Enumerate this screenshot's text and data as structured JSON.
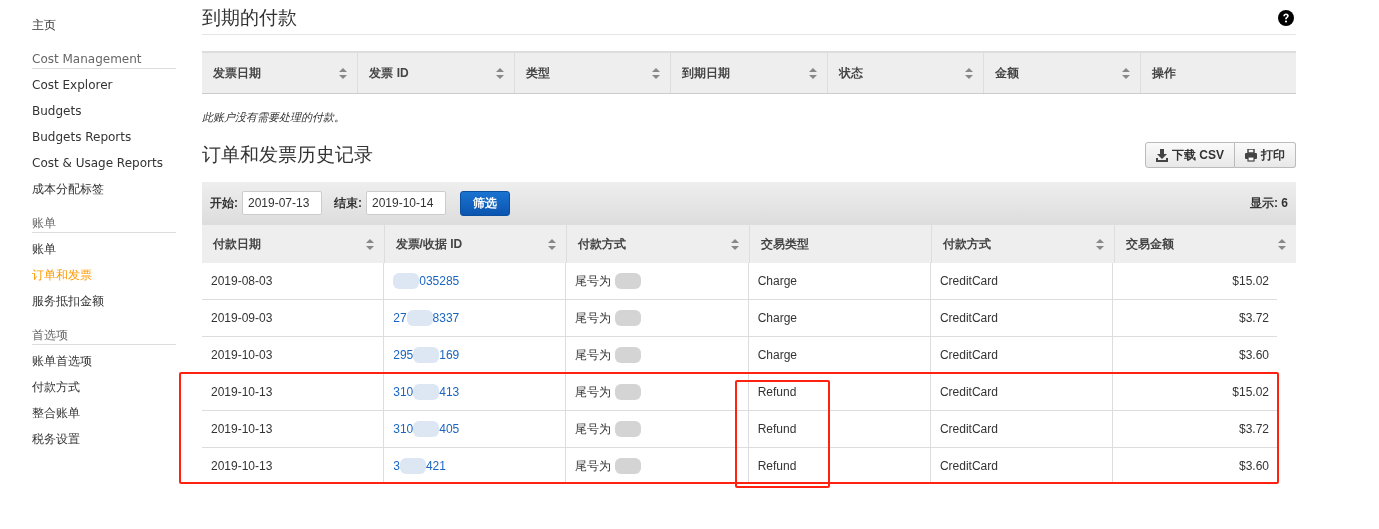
{
  "sidebar": {
    "sections": [
      {
        "items": [
          {
            "label": "主页",
            "selected": false
          }
        ]
      },
      {
        "heading": "Cost Management",
        "items": [
          {
            "label": "Cost Explorer",
            "selected": false
          },
          {
            "label": "Budgets",
            "selected": false
          },
          {
            "label": "Budgets Reports",
            "selected": false
          },
          {
            "label": "Cost & Usage Reports",
            "selected": false
          },
          {
            "label": "成本分配标签",
            "selected": false
          }
        ]
      },
      {
        "heading": "账单",
        "items": [
          {
            "label": "账单",
            "selected": false
          },
          {
            "label": "订单和发票",
            "selected": true
          },
          {
            "label": "服务抵扣金额",
            "selected": false
          }
        ]
      },
      {
        "heading": "首选项",
        "items": [
          {
            "label": "账单首选项",
            "selected": false
          },
          {
            "label": "付款方式",
            "selected": false
          },
          {
            "label": "整合账单",
            "selected": false
          },
          {
            "label": "税务设置",
            "selected": false
          }
        ]
      }
    ]
  },
  "due_payments": {
    "title": "到期的付款",
    "columns": [
      {
        "label": "发票日期",
        "sortable": true
      },
      {
        "label": "发票 ID",
        "sortable": true
      },
      {
        "label": "类型",
        "sortable": true
      },
      {
        "label": "到期日期",
        "sortable": true
      },
      {
        "label": "状态",
        "sortable": true
      },
      {
        "label": "金额",
        "sortable": true
      },
      {
        "label": "操作",
        "sortable": false
      }
    ],
    "empty_message": "此账户没有需要处理的付款。"
  },
  "history": {
    "title": "订单和发票历史记录",
    "buttons": [
      {
        "label": "下载 CSV",
        "kind": "download"
      },
      {
        "label": "打印",
        "kind": "print"
      }
    ],
    "filter": {
      "start_label": "开始:",
      "start_value": "2019-07-13",
      "end_label": "结束:",
      "end_value": "2019-10-14",
      "button": "筛选",
      "count": "显示: 6"
    },
    "columns": [
      {
        "label": "付款日期",
        "sortable": true
      },
      {
        "label": "发票/收据 ID",
        "sortable": true
      },
      {
        "label": "付款方式",
        "sortable": true
      },
      {
        "label": "交易类型",
        "sortable": false
      },
      {
        "label": "付款方式",
        "sortable": true
      },
      {
        "label": "交易金额",
        "sortable": true
      }
    ],
    "rows": [
      {
        "date": "2019-08-03",
        "id_start": "",
        "id_end": "035285",
        "payment": "尾号为",
        "type": "Charge",
        "method": "CreditCard",
        "amount": "$15.02",
        "highlighted": false
      },
      {
        "date": "2019-09-03",
        "id_start": "27",
        "id_end": "8337",
        "payment": "尾号为",
        "type": "Charge",
        "method": "CreditCard",
        "amount": "$3.72",
        "highlighted": false
      },
      {
        "date": "2019-10-03",
        "id_start": "295",
        "id_end": "169",
        "payment": "尾号为",
        "type": "Charge",
        "method": "CreditCard",
        "amount": "$3.60",
        "highlighted": false
      },
      {
        "date": "2019-10-13",
        "id_start": "310",
        "id_end": "413",
        "payment": "尾号为",
        "type": "Refund",
        "method": "CreditCard",
        "amount": "$15.02",
        "highlighted": true
      },
      {
        "date": "2019-10-13",
        "id_start": "310",
        "id_end": "405",
        "payment": "尾号为",
        "type": "Refund",
        "method": "CreditCard",
        "amount": "$3.72",
        "highlighted": true
      },
      {
        "date": "2019-10-13",
        "id_start": "3",
        "id_end": "421",
        "payment": "尾号为",
        "type": "Refund",
        "method": "CreditCard",
        "amount": "$3.60",
        "highlighted": true
      }
    ]
  }
}
